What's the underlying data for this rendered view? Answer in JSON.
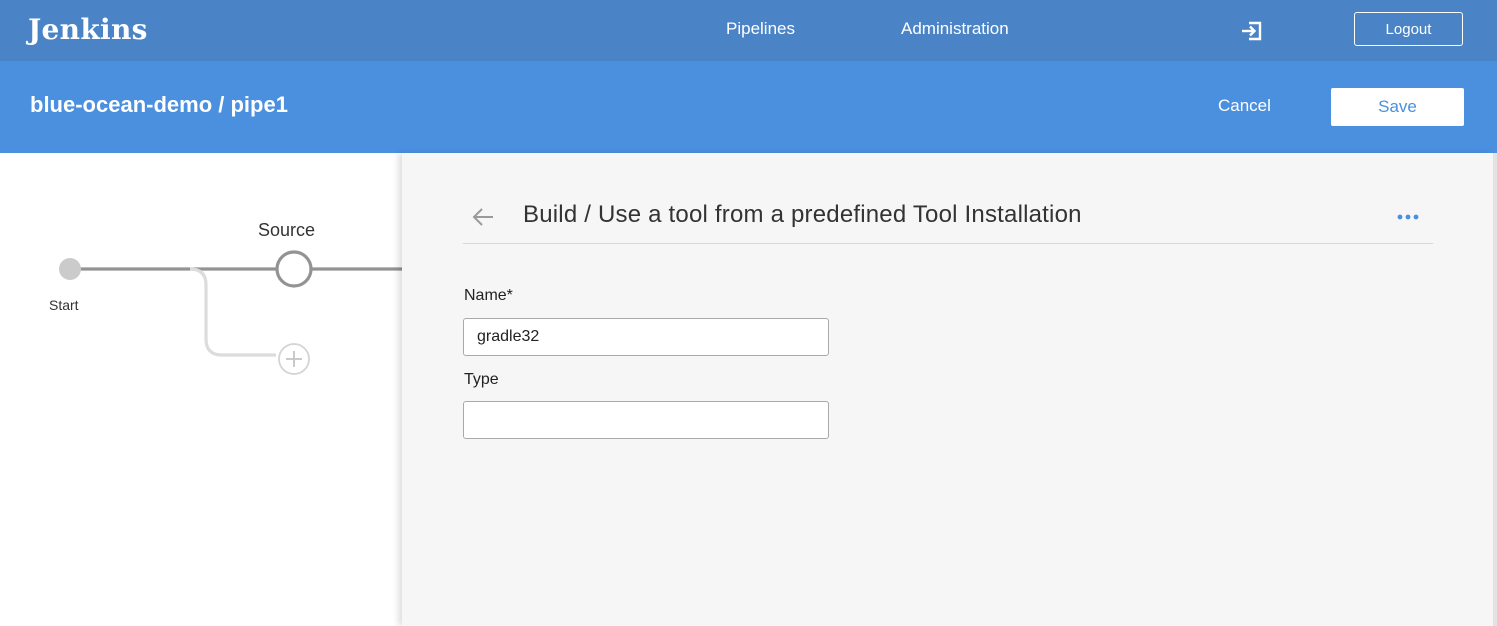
{
  "topbar": {
    "logo": "Jenkins",
    "nav": [
      "Pipelines",
      "Administration"
    ],
    "exit_icon": "exit-icon",
    "logout_label": "Logout"
  },
  "header": {
    "breadcrumb": "blue-ocean-demo / pipe1",
    "cancel_label": "Cancel",
    "save_label": "Save"
  },
  "pipeline": {
    "start_label": "Start",
    "stages": [
      "Source"
    ],
    "add_icon": "plus-circle-icon"
  },
  "step_panel": {
    "title": "Build / Use a tool from a predefined Tool Installation",
    "more_icon": "more-dots-icon",
    "back_icon": "arrow-left-icon",
    "fields": {
      "name": {
        "label": "Name*",
        "value": "gradle32"
      },
      "type": {
        "label": "Type",
        "value": ""
      }
    }
  },
  "colors": {
    "topbar": "#4a84c6",
    "header": "#4a90df",
    "panel_bg": "#f6f6f6"
  }
}
